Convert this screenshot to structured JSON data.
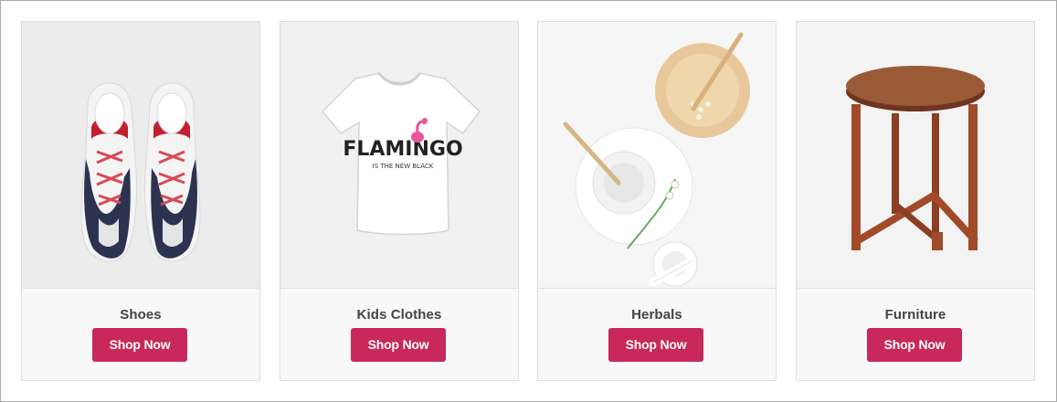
{
  "products": [
    {
      "title": "Shoes",
      "button_label": "Shop Now",
      "image_icon": "sneakers-image"
    },
    {
      "title": "Kids Clothes",
      "button_label": "Shop Now",
      "image_icon": "tshirt-image",
      "shirt_print": [
        "FLAMINGO",
        "IS THE NEW BLACK"
      ]
    },
    {
      "title": "Herbals",
      "button_label": "Shop Now",
      "image_icon": "herbal-bowls-image"
    },
    {
      "title": "Furniture",
      "button_label": "Shop Now",
      "image_icon": "wooden-stool-image"
    }
  ],
  "colors": {
    "button_bg": "#c8285b",
    "button_text": "#ffffff",
    "title_text": "#444444",
    "card_border": "#dedede",
    "image_bg": "#f3f3f3"
  }
}
